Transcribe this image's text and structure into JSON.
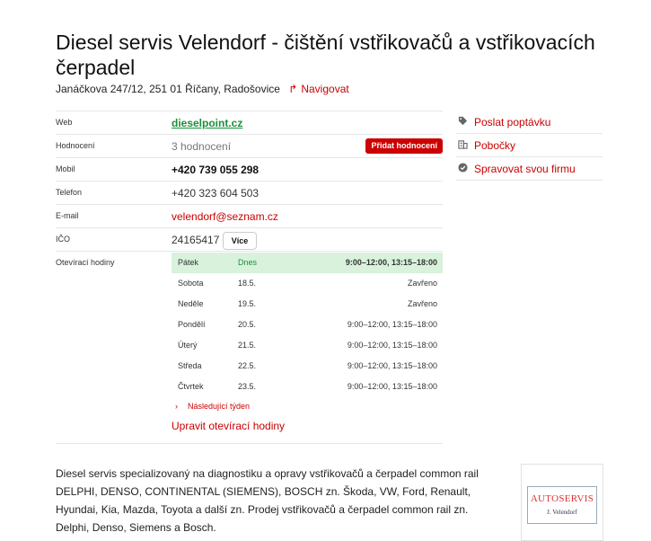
{
  "header": {
    "title": "Diesel servis Velendorf - čištění vstřikovačů a vstřikovacích čerpadel",
    "address": "Janáčkova 247/12, 251 01 Říčany, Radošovice",
    "navigate_label": "Navigovat"
  },
  "info": {
    "web": {
      "label": "Web",
      "value": "dieselpoint.cz"
    },
    "rating": {
      "label": "Hodnocení",
      "value": "3 hodnocení",
      "button": "Přidat hodnocení"
    },
    "mobile": {
      "label": "Mobil",
      "value": "+420 739 055 298"
    },
    "phone": {
      "label": "Telefon",
      "value": "+420 323 604 503"
    },
    "email": {
      "label": "E-mail",
      "value": "velendorf@seznam.cz"
    },
    "ico": {
      "label": "IČO",
      "value": "24165417",
      "button": "Více"
    },
    "hours": {
      "label": "Otevírací hodiny",
      "days": [
        {
          "day": "Pátek",
          "date": "Dnes",
          "time": "9:00–12:00, 13:15–18:00"
        },
        {
          "day": "Sobota",
          "date": "18.5.",
          "time": "Zavřeno"
        },
        {
          "day": "Neděle",
          "date": "19.5.",
          "time": "Zavřeno"
        },
        {
          "day": "Pondělí",
          "date": "20.5.",
          "time": "9:00–12:00, 13:15–18:00"
        },
        {
          "day": "Úterý",
          "date": "21.5.",
          "time": "9:00–12:00, 13:15–18:00"
        },
        {
          "day": "Středa",
          "date": "22.5.",
          "time": "9:00–12:00, 13:15–18:00"
        },
        {
          "day": "Čtvrtek",
          "date": "23.5.",
          "time": "9:00–12:00, 13:15–18:00"
        }
      ],
      "next_week": "Následující týden",
      "edit": "Upravit otevírací hodiny"
    }
  },
  "sidebar": {
    "items": [
      {
        "label": "Poslat poptávku",
        "icon": "tag-icon"
      },
      {
        "label": "Pobočky",
        "icon": "building-icon"
      },
      {
        "label": "Spravovat svou firmu",
        "icon": "verified-badge-icon"
      }
    ]
  },
  "description": "Diesel servis specializovaný na diagnostiku a opravy vstřikovačů a čerpadel common rail DELPHI, DENSO, CONTINENTAL (SIEMENS), BOSCH zn. Škoda, VW, Ford, Renault, Hyundai, Kia, Mazda, Toyota a další zn. Prodej vstřikovačů a čerpadel common rail zn. Delphi, Denso, Siemens a Bosch.",
  "logo": {
    "top": "AUTOSERVIS",
    "bottom": "J. Velendorf"
  },
  "colors": {
    "accent": "#cc0000",
    "link_green": "#1a8f3a",
    "today_bg": "#d8f2dc"
  }
}
